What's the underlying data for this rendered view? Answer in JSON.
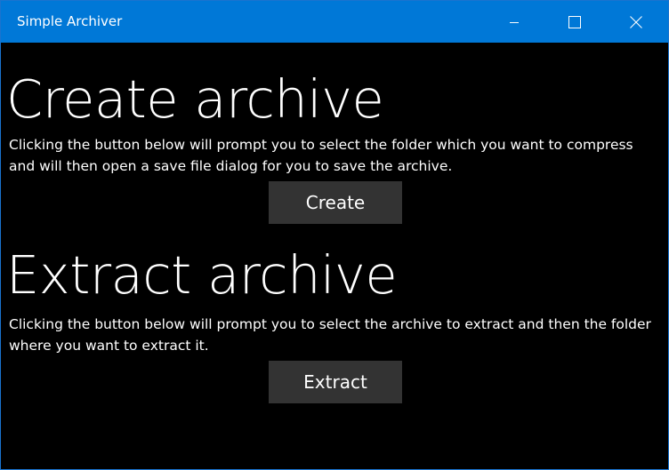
{
  "window": {
    "title": "Simple Archiver",
    "controls": {
      "minimize": "minimize-icon",
      "maximize": "maximize-icon",
      "close": "close-icon"
    }
  },
  "create": {
    "heading": "Create archive",
    "description": "Clicking the button below will prompt you to select the folder which you want to compress and will then open a save file dialog for you to save the archive.",
    "button_label": "Create"
  },
  "extract": {
    "heading": "Extract archive",
    "description": "Clicking the button below will prompt you to select the archive to extract and then the folder where you want to extract it.",
    "button_label": "Extract"
  },
  "colors": {
    "titlebar": "#0078d7",
    "background": "#000000",
    "button": "#333333",
    "text": "#ffffff"
  }
}
